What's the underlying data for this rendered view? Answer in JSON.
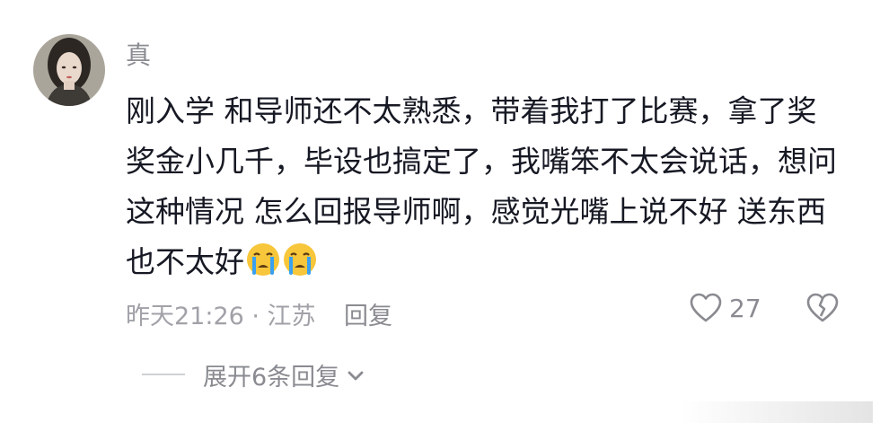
{
  "comment": {
    "username": "真",
    "text": "刚入学 和导师还不太熟悉，带着我打了比赛，拿了奖奖金小几千，毕设也搞定了，我嘴笨不太会说话，想问这种情况 怎么回报导师啊，感觉光嘴上说不好 送东西也不太好",
    "emojis": [
      "crying-face",
      "crying-face"
    ],
    "time_location": "昨天21:26 · 江苏",
    "reply_label": "回复",
    "like_count": "27"
  },
  "replies": {
    "expand_label": "展开6条回复"
  },
  "icons": {
    "like": "heart-outline-icon",
    "dislike": "broken-heart-icon",
    "expand": "chevron-down-icon"
  },
  "colors": {
    "text": "#161823",
    "muted": "#8a8b91",
    "emoji_face": "#f7c63a",
    "emoji_tears": "#3aa0f0"
  }
}
